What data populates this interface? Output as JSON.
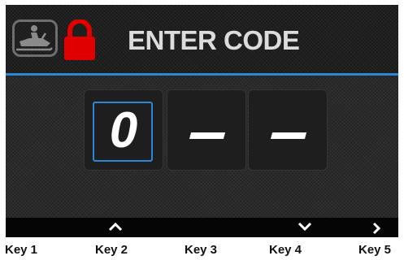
{
  "header": {
    "title": "ENTER CODE",
    "icons": [
      "snowmobile-icon",
      "lock-icon"
    ],
    "accent_color": "#2e86d6",
    "lock_color": "#e00000"
  },
  "code_entry": {
    "digits": [
      {
        "value": "0",
        "selected": true
      },
      {
        "value": "",
        "selected": false
      },
      {
        "value": "",
        "selected": false
      }
    ]
  },
  "softkeys": [
    {
      "key": 1,
      "icon": ""
    },
    {
      "key": 2,
      "icon": "chevron-up-icon"
    },
    {
      "key": 3,
      "icon": ""
    },
    {
      "key": 4,
      "icon": "chevron-down-icon"
    },
    {
      "key": 5,
      "icon": "chevron-right-icon"
    }
  ],
  "key_labels": [
    "Key 1",
    "Key 2",
    "Key 3",
    "Key 4",
    "Key 5"
  ]
}
